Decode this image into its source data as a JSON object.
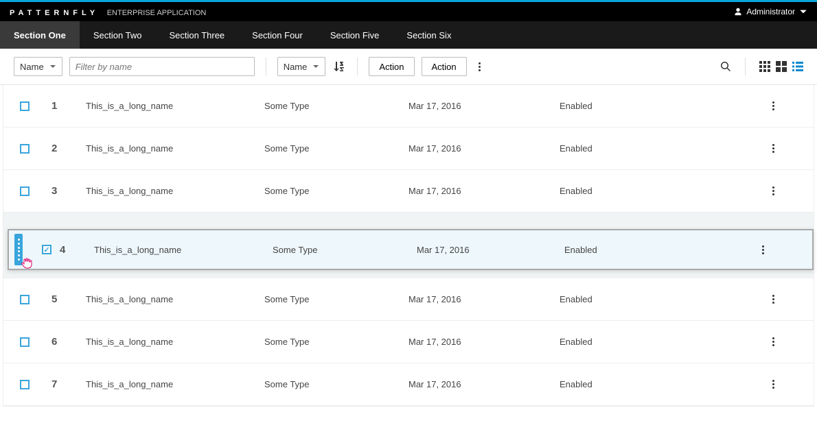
{
  "brand": {
    "name": "PATTERNFLY",
    "sub": "ENTERPRISE APPLICATION"
  },
  "user": {
    "name": "Administrator"
  },
  "nav": [
    {
      "label": "Section One",
      "active": true
    },
    {
      "label": "Section Two"
    },
    {
      "label": "Section Three"
    },
    {
      "label": "Section Four"
    },
    {
      "label": "Section Five"
    },
    {
      "label": "Section Six"
    }
  ],
  "toolbar": {
    "filter_dropdown": "Name",
    "filter_placeholder": "Filter by name",
    "sort_dropdown": "Name",
    "action1": "Action",
    "action2": "Action"
  },
  "rows": [
    {
      "num": "1",
      "name": "This_is_a_long_name",
      "type": "Some Type",
      "date": "Mar 17, 2016",
      "status": "Enabled",
      "checked": false
    },
    {
      "num": "2",
      "name": "This_is_a_long_name",
      "type": "Some Type",
      "date": "Mar 17, 2016",
      "status": "Enabled",
      "checked": false
    },
    {
      "num": "3",
      "name": "This_is_a_long_name",
      "type": "Some Type",
      "date": "Mar 17, 2016",
      "status": "Enabled",
      "checked": false
    },
    {
      "num": "4",
      "name": "This_is_a_long_name",
      "type": "Some Type",
      "date": "Mar 17, 2016",
      "status": "Enabled",
      "checked": true,
      "dragging": true
    },
    {
      "num": "5",
      "name": "This_is_a_long_name",
      "type": "Some Type",
      "date": "Mar 17, 2016",
      "status": "Enabled",
      "checked": false
    },
    {
      "num": "6",
      "name": "This_is_a_long_name",
      "type": "Some Type",
      "date": "Mar 17, 2016",
      "status": "Enabled",
      "checked": false
    },
    {
      "num": "7",
      "name": "This_is_a_long_name",
      "type": "Some Type",
      "date": "Mar 17, 2016",
      "status": "Enabled",
      "checked": false
    }
  ]
}
